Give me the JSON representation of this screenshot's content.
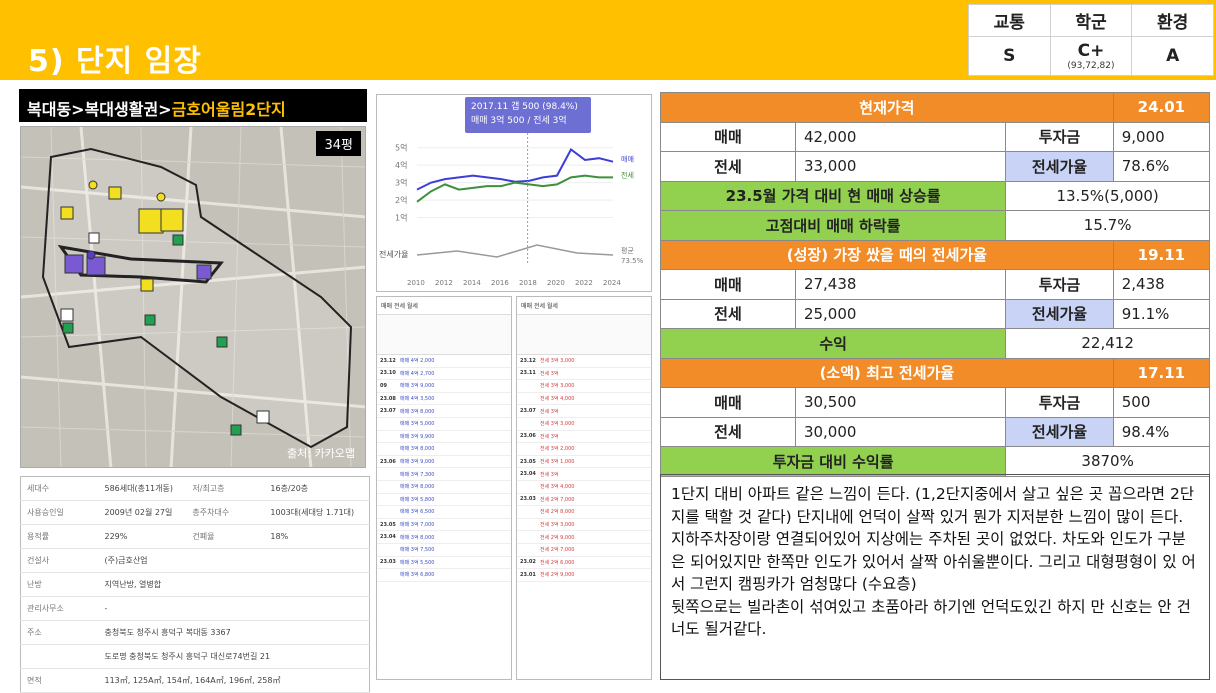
{
  "header": {
    "title": "5) 단지 임장"
  },
  "grades": {
    "headers": [
      "교통",
      "학군",
      "환경"
    ],
    "values": [
      "S",
      "C+",
      "A"
    ],
    "school_detail": "(93,72,82)"
  },
  "location": {
    "path": "복대동>복대생활권>",
    "complex": "금호어울림2단지"
  },
  "map": {
    "size_badge": "34평",
    "credit": "출처: 카카오맵"
  },
  "info": {
    "rows": [
      [
        "세대수",
        "586세대(총11개동)",
        "저/최고층",
        "16층/20층"
      ],
      [
        "사용승인일",
        "2009년 02월 27일",
        "총주차대수",
        "1003대(세대당 1.71대)"
      ],
      [
        "용적률",
        "229%",
        "건폐율",
        "18%"
      ],
      [
        "건설사",
        "(주)금호산업",
        "",
        ""
      ],
      [
        "난방",
        "지역난방, 열병합",
        "",
        ""
      ],
      [
        "관리사무소",
        "-",
        "",
        ""
      ],
      [
        "주소",
        "충청북도 청주시 흥덕구 복대동 3367",
        "",
        ""
      ],
      [
        "",
        "도로명 충청북도 청주시 흥덕구 대신로74번길 21",
        "",
        ""
      ],
      [
        "면적",
        "113㎡, 125A㎡, 154㎡, 164A㎡, 196㎡, 258㎡",
        "",
        ""
      ]
    ]
  },
  "chart": {
    "tooltip_line1": "2017.11 갭 500 (98.4%)",
    "tooltip_line2": "매매 3억 500 / 전세 3억",
    "y_ticks": [
      "5억",
      "4억",
      "3억",
      "2억",
      "1억"
    ],
    "x_ticks": [
      "2010",
      "2012",
      "2014",
      "2016",
      "2018",
      "2020",
      "2022",
      "2024"
    ],
    "legend_buy": "매매",
    "legend_jeonse": "전세",
    "ratio_label": "전세가율",
    "ratio_avg_label": "평균",
    "ratio_avg_value": "73.5%"
  },
  "chart_data": {
    "type": "line",
    "x": [
      2010,
      2011,
      2012,
      2013,
      2014,
      2015,
      2016,
      2017,
      2018,
      2019,
      2020,
      2021,
      2022,
      2023,
      2024
    ],
    "series": [
      {
        "name": "매매",
        "values": [
          2.6,
          3.0,
          3.2,
          3.3,
          3.4,
          3.3,
          3.2,
          3.05,
          3.1,
          3.3,
          3.4,
          4.9,
          4.3,
          4.4,
          4.2
        ]
      },
      {
        "name": "전세",
        "values": [
          1.9,
          2.5,
          2.9,
          2.6,
          2.7,
          2.8,
          2.8,
          3.0,
          2.9,
          2.8,
          2.9,
          3.3,
          3.4,
          3.3,
          3.3
        ]
      }
    ],
    "ylim": [
      0,
      5.5
    ]
  },
  "list_left": {
    "tabs": "매매  전세  월세",
    "rows": [
      [
        "23.12",
        "매매 4억 2,000"
      ],
      [
        "23.10",
        "매매 4억 2,700"
      ],
      [
        "09",
        "매매 3억 9,000"
      ],
      [
        "23.08",
        "매매 4억 3,500"
      ],
      [
        "23.07",
        "매매 3억 8,000"
      ],
      [
        "",
        "매매 3억 5,000"
      ],
      [
        "",
        "매매 3억 9,900"
      ],
      [
        "",
        "매매 3억 8,000"
      ],
      [
        "23.06",
        "매매 3억 9,000"
      ],
      [
        "",
        "매매 3억 7,300"
      ],
      [
        "",
        "매매 3억 8,000"
      ],
      [
        "",
        "매매 3억 5,800"
      ],
      [
        "",
        "매매 3억 6,500"
      ],
      [
        "23.05",
        "매매 3억 7,000"
      ],
      [
        "23.04",
        "매매 3억 8,000"
      ],
      [
        "",
        "매매 3억 7,500"
      ],
      [
        "23.03",
        "매매 3억 5,500"
      ],
      [
        "",
        "매매 3억 6,800"
      ]
    ]
  },
  "list_right": {
    "tabs": "매매  전세  월세",
    "rows": [
      [
        "23.12",
        "전세 3억 3,000"
      ],
      [
        "23.11",
        "전세 3억"
      ],
      [
        "",
        "전세 3억 3,000"
      ],
      [
        "",
        "전세 3억 4,000"
      ],
      [
        "23.07",
        "전세 3억"
      ],
      [
        "",
        "전세 3억 3,000"
      ],
      [
        "23.06",
        "전세 3억"
      ],
      [
        "",
        "전세 3억 2,000"
      ],
      [
        "23.05",
        "전세 3억 1,000"
      ],
      [
        "23.04",
        "전세 3억"
      ],
      [
        "",
        "전세 3억 4,000"
      ],
      [
        "23.03",
        "전세 2억 7,000"
      ],
      [
        "",
        "전세 2억 8,000"
      ],
      [
        "",
        "전세 3억 3,000"
      ],
      [
        "",
        "전세 2억 9,000"
      ],
      [
        "",
        "전세 2억 7,000"
      ],
      [
        "23.02",
        "전세 2억 6,000"
      ],
      [
        "23.01",
        "전세 2억 9,000"
      ]
    ]
  },
  "metrics": {
    "current_title": "현재가격",
    "current_date": "24.01",
    "current_buy_label": "매매",
    "current_buy": "42,000",
    "current_invest_label": "투자금",
    "current_invest": "9,000",
    "current_jeonse_label": "전세",
    "current_jeonse": "33,000",
    "current_ratio_label": "전세가율",
    "current_ratio": "78.6%",
    "rise_label": "23.5월 가격 대비 현 매매 상승률",
    "rise_value": "13.5%(5,000)",
    "drop_label": "고점대비 매매 하락률",
    "drop_value": "15.7%",
    "growth_title": "(성장) 가장 쌌을 때의 전세가율",
    "growth_date": "19.11",
    "growth_buy_label": "매매",
    "growth_buy": "27,438",
    "growth_invest_label": "투자금",
    "growth_invest": "2,438",
    "growth_jeonse_label": "전세",
    "growth_jeonse": "25,000",
    "growth_ratio_label": "전세가율",
    "growth_ratio": "91.1%",
    "profit_label": "수익",
    "profit_value": "22,412",
    "consume_title": "(소액) 최고 전세가율",
    "consume_date": "17.11",
    "consume_buy_label": "매매",
    "consume_buy": "30,500",
    "consume_invest_label": "투자금",
    "consume_invest": "500",
    "consume_jeonse_label": "전세",
    "consume_jeonse": "30,000",
    "consume_ratio_label": "전세가율",
    "consume_ratio": "98.4%",
    "roi_label": "투자금 대비 수익률",
    "roi_value": "3870%"
  },
  "review": {
    "text": "1단지 대비 아파트 같은 느낌이 든다. (1,2단지중에서 살고 싶은 곳 꼽으라면 2단지를 택할 것 같다) 단지내에 언덕이 살짝 있거 뭔가 지저분한 느낌이 많이 든다. 지하주차장이랑 연결되어있어 지상에는 주차된 곳이 없었다. 차도와 인도가 구분은 되어있지만 한쪽만 인도가 있어서 살짝 아쉬울뿐이다. 그리고 대형평형이 있 어서 그런지 캠핑카가 엄청많다 (수요층)",
    "text2": "뒷쪽으로는 빌라촌이 섞여있고 초품아라 하기엔 언덕도있긴 하지 만 신호는 안 건너도 될거같다."
  }
}
